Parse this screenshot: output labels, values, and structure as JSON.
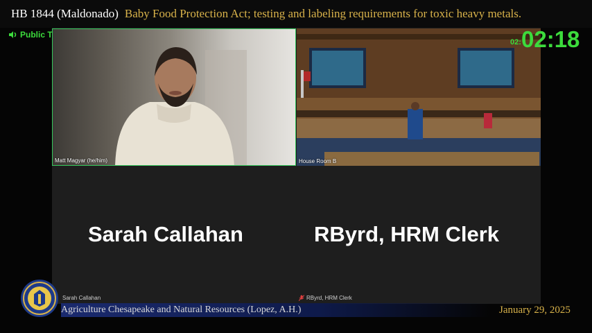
{
  "header": {
    "bill_id": "HB 1844 (Maldonado)",
    "bill_description": "Baby Food Protection Act; testing and labeling requirements for toxic heavy metals."
  },
  "status": {
    "label": "Public Testimony",
    "timer_small": "02:",
    "timer": "02:18",
    "accent_color": "#3cdb3c"
  },
  "tiles": [
    {
      "name": "Matt Magyar (he/him)",
      "type": "video",
      "active": true
    },
    {
      "name": "House Room B",
      "type": "video",
      "active": false
    },
    {
      "display_name": "Sarah Callahan",
      "caption": "Sarah Callahan",
      "type": "name-card"
    },
    {
      "display_name": "RByrd, HRM Clerk",
      "caption": "RByrd, HRM Clerk",
      "type": "name-card",
      "icon": "microphone-muted-icon"
    }
  ],
  "footer": {
    "committee": "Agriculture Chesapeake and Natural Resources (Lopez, A.H.)",
    "date": "January 29, 2025",
    "seal_icon": "house-seal-icon"
  }
}
